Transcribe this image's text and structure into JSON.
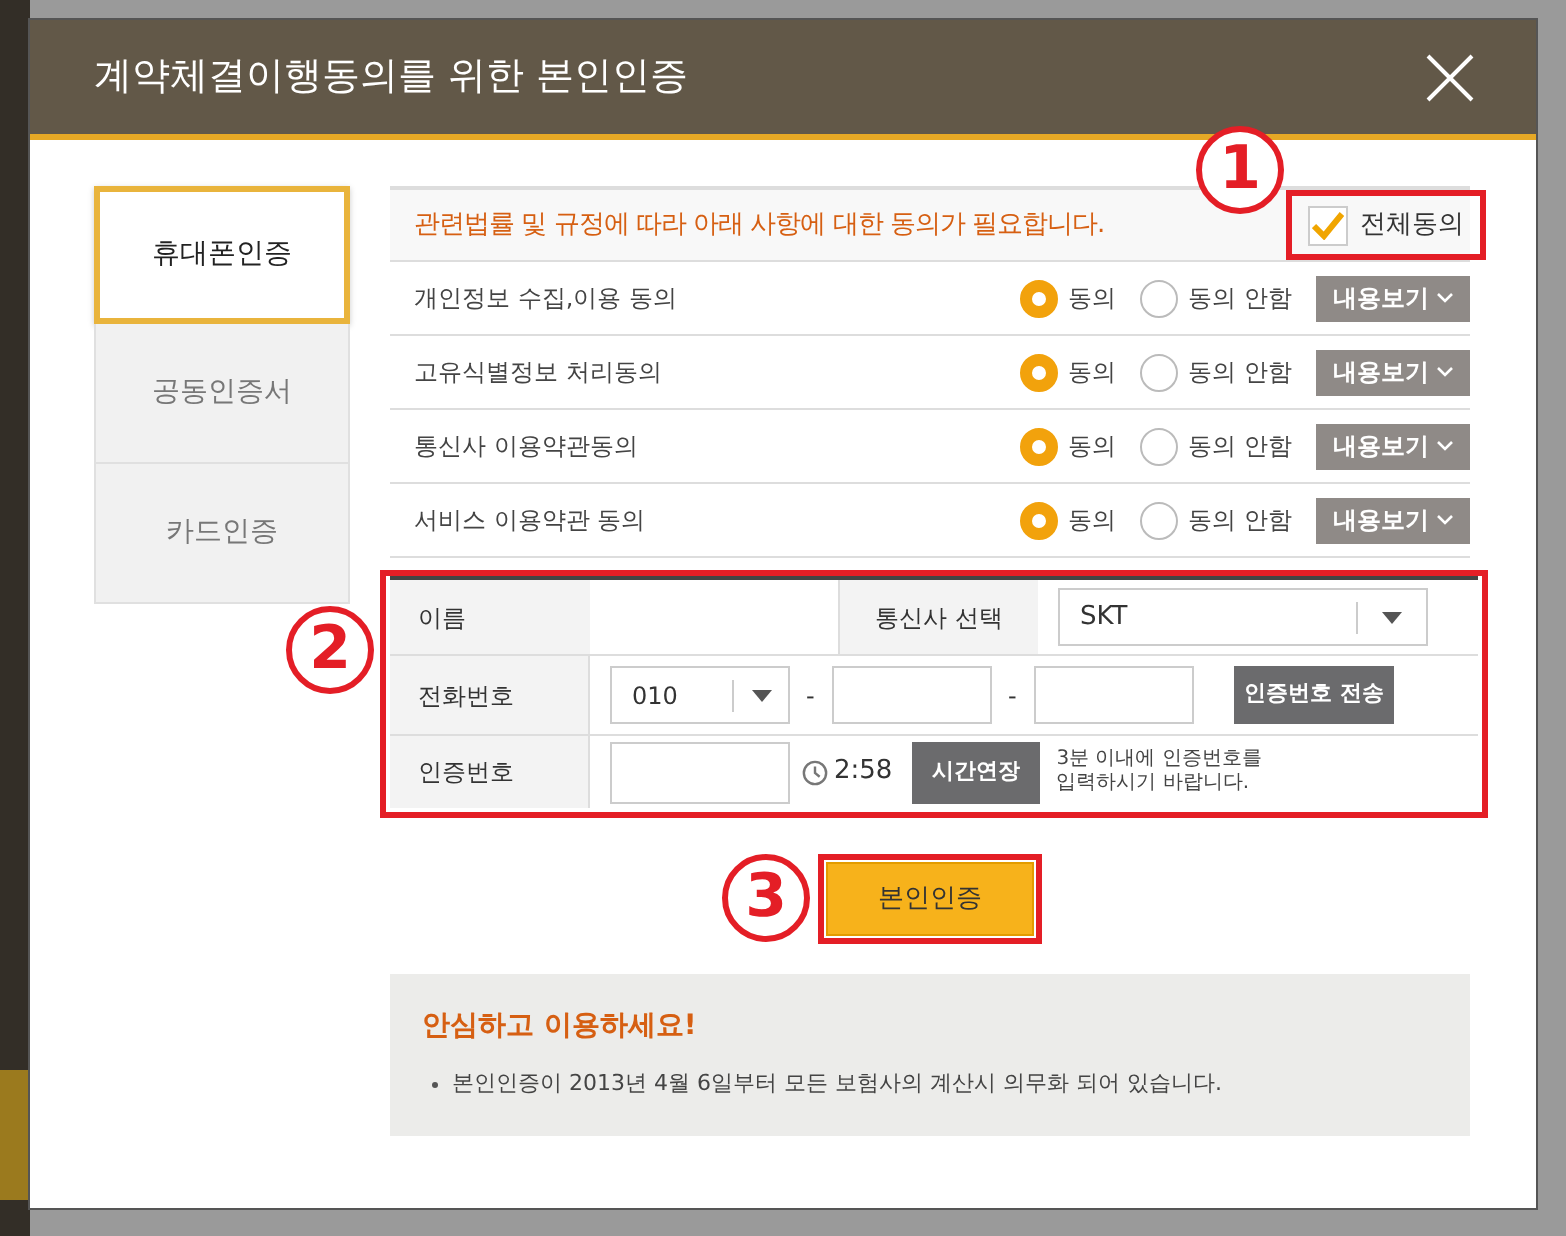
{
  "dialog": {
    "title": "계약체결이행동의를 위한 본인인증"
  },
  "tabs": [
    {
      "label": "휴대폰인증",
      "selected": true
    },
    {
      "label": "공동인증서",
      "selected": false
    },
    {
      "label": "카드인증",
      "selected": false
    }
  ],
  "consent": {
    "notice": "관련법률 및 규정에 따라 아래 사항에 대한 동의가 필요합니다.",
    "agree_all": {
      "label": "전체동의",
      "checked": true
    },
    "items": [
      {
        "label": "개인정보 수집,이용 동의",
        "options": [
          {
            "label": "동의",
            "selected": true
          },
          {
            "label": "동의 안함",
            "selected": false
          }
        ],
        "button": "내용보기"
      },
      {
        "label": "고유식별정보 처리동의",
        "options": [
          {
            "label": "동의",
            "selected": true
          },
          {
            "label": "동의 안함",
            "selected": false
          }
        ],
        "button": "내용보기"
      },
      {
        "label": "통신사 이용약관동의",
        "options": [
          {
            "label": "동의",
            "selected": true
          },
          {
            "label": "동의 안함",
            "selected": false
          }
        ],
        "button": "내용보기"
      },
      {
        "label": "서비스 이용약관 동의",
        "options": [
          {
            "label": "동의",
            "selected": true
          },
          {
            "label": "동의 안함",
            "selected": false
          }
        ],
        "button": "내용보기"
      }
    ]
  },
  "form": {
    "name_label": "이름",
    "carrier_label": "통신사 선택",
    "carrier": "SKT",
    "phone_label": "전화번호",
    "phone_prefix": "010",
    "phone_separators": [
      "-",
      "-"
    ],
    "send_button": "인증번호 전송",
    "code_label": "인증번호",
    "timer": "2:58",
    "extend_button": "시간연장",
    "hint_lines": [
      "3분 이내에 인증번호를",
      "입력하시기 바랍니다."
    ]
  },
  "submit": "본인인증",
  "info": {
    "title": "안심하고 이용하세요!",
    "items": [
      "본인인증이 2013년 4월 6일부터 모든 보험사의 계산시 의무화 되어 있습니다."
    ]
  },
  "annotations": [
    {
      "label": "1"
    },
    {
      "label": "2"
    },
    {
      "label": "3"
    }
  ]
}
